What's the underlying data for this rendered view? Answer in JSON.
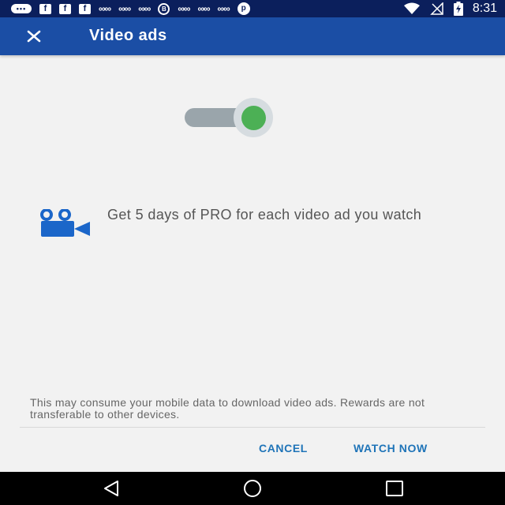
{
  "status_bar": {
    "time": "8:31",
    "notification_icons": [
      "chat-bubble-icon",
      "facebook-icon",
      "facebook-icon",
      "facebook-icon",
      "infinity-loop-icon",
      "infinity-loop-icon",
      "infinity-loop-icon",
      "b-circle-icon",
      "infinity-loop-icon",
      "infinity-loop-icon",
      "infinity-loop-icon",
      "pinterest-icon"
    ],
    "system_icons": [
      "wifi-icon",
      "signal-icon",
      "battery-charging-icon"
    ]
  },
  "app_bar": {
    "title": "Video ads",
    "close_icon": "close-icon"
  },
  "toggle": {
    "state": "on",
    "on_color": "#4cb055"
  },
  "feature": {
    "icon": "video-camera-icon",
    "text": "Get 5 days of PRO for each video ad you watch"
  },
  "disclaimer": "This may consume your mobile data to download video ads. Rewards are not transferable to other devices.",
  "actions": {
    "cancel_label": "CANCEL",
    "watch_label": "WATCH NOW"
  },
  "nav_bar": {
    "icons": [
      "back-icon",
      "home-icon",
      "recents-icon"
    ]
  },
  "colors": {
    "status_bar": "#0b1f5c",
    "app_bar": "#1b4ea5",
    "accent_text": "#1f74b8",
    "background": "#f2f2f2"
  }
}
